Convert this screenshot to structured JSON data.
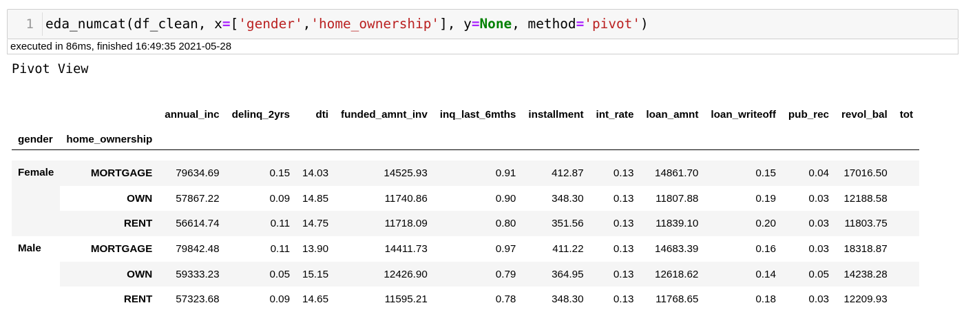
{
  "cell": {
    "line_number": "1",
    "code": {
      "fn": "eda_numcat(df_clean, x",
      "eq1": "=",
      "lb": "[",
      "s1": "'gender'",
      "comma": ",",
      "s2": "'home_ownership'",
      "rb": "], y",
      "eq2": "=",
      "none": "None",
      "mid": ", method",
      "eq3": "=",
      "s3": "'pivot'",
      "end": ")"
    },
    "exec_info": "executed in 86ms, finished 16:49:35 2021-05-28"
  },
  "output": {
    "title": "Pivot View",
    "index_names": [
      "gender",
      "home_ownership"
    ],
    "columns": [
      "annual_inc",
      "delinq_2yrs",
      "dti",
      "funded_amnt_inv",
      "inq_last_6mths",
      "installment",
      "int_rate",
      "loan_amnt",
      "loan_writeoff",
      "pub_rec",
      "revol_bal",
      "tot"
    ],
    "groups": [
      {
        "name": "Female",
        "rows": [
          {
            "label": "MORTGAGE",
            "values": [
              "79634.69",
              "0.15",
              "14.03",
              "14525.93",
              "0.91",
              "412.87",
              "0.13",
              "14861.70",
              "0.15",
              "0.04",
              "17016.50"
            ]
          },
          {
            "label": "OWN",
            "values": [
              "57867.22",
              "0.09",
              "14.85",
              "11740.86",
              "0.90",
              "348.30",
              "0.13",
              "11807.88",
              "0.19",
              "0.03",
              "12188.58"
            ]
          },
          {
            "label": "RENT",
            "values": [
              "56614.74",
              "0.11",
              "14.75",
              "11718.09",
              "0.80",
              "351.56",
              "0.13",
              "11839.10",
              "0.20",
              "0.03",
              "11803.75"
            ]
          }
        ]
      },
      {
        "name": "Male",
        "rows": [
          {
            "label": "MORTGAGE",
            "values": [
              "79842.48",
              "0.11",
              "13.90",
              "14411.73",
              "0.97",
              "411.22",
              "0.13",
              "14683.39",
              "0.16",
              "0.03",
              "18318.87"
            ]
          },
          {
            "label": "OWN",
            "values": [
              "59333.23",
              "0.05",
              "15.15",
              "12426.90",
              "0.79",
              "364.95",
              "0.13",
              "12618.62",
              "0.14",
              "0.05",
              "14238.28"
            ]
          },
          {
            "label": "RENT",
            "values": [
              "57323.68",
              "0.09",
              "14.65",
              "11595.21",
              "0.78",
              "348.30",
              "0.13",
              "11768.65",
              "0.18",
              "0.03",
              "12209.93"
            ]
          }
        ]
      }
    ]
  }
}
